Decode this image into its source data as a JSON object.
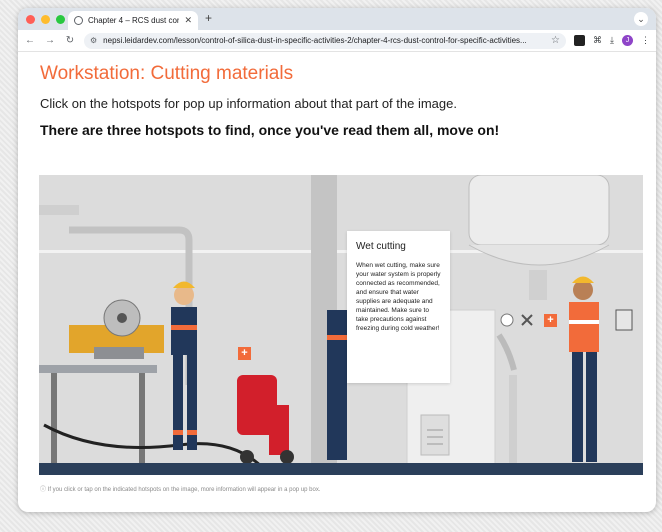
{
  "browser": {
    "tab_title": "Chapter 4 – RCS dust control",
    "url": "nepsi.leidardev.com/lesson/control-of-silica-dust-in-specific-activities-2/chapter-4-rcs-dust-control-for-specific-activities...",
    "avatar_letter": "J"
  },
  "page": {
    "heading": "Workstation: Cutting materials",
    "instruction": "Click on the hotspots for pop up information about that part of the image.",
    "instruction_bold": "There are three hotspots to find, once you've read them all, move on!",
    "caption": "If you click or tap on the indicated hotspots on the image, more information will appear in a pop up box."
  },
  "popup": {
    "title": "Wet cutting",
    "body": "When wet cutting, make sure your water system is properly connected as recommended, and ensure that water supplies are adequate and maintained. Make sure to take precautions against freezing during cold weather!"
  },
  "hotspots": [
    "+",
    "+"
  ],
  "colors": {
    "accent": "#f26b3a",
    "floor": "#2b3f5a",
    "background_scene": "#dcdcdc"
  }
}
